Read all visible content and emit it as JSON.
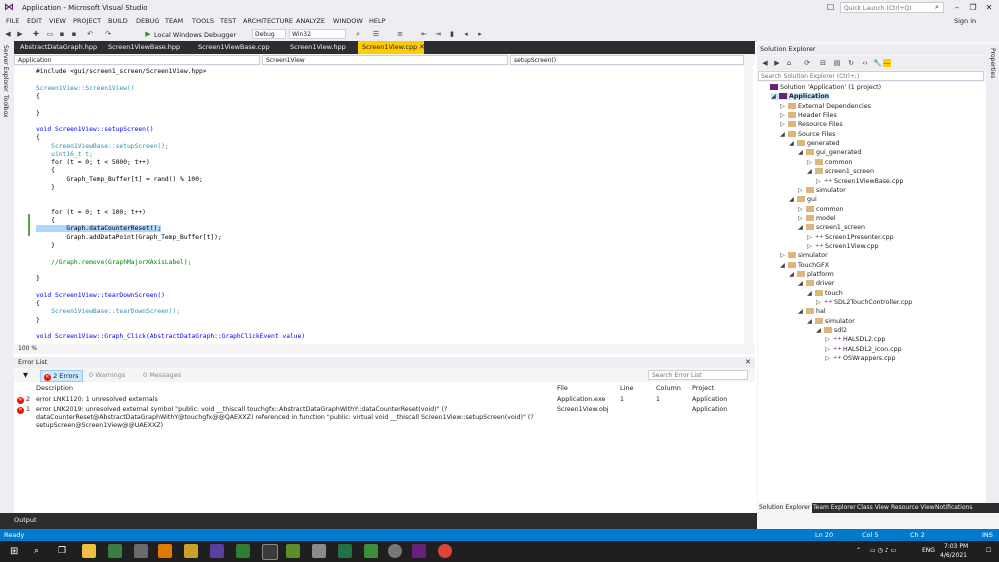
{
  "window": {
    "title": "Application - Microsoft Visual Studio",
    "quick_launch_placeholder": "Quick Launch (Ctrl+Q)",
    "sign_in": "Sign in"
  },
  "menu": [
    "FILE",
    "EDIT",
    "VIEW",
    "PROJECT",
    "BUILD",
    "DEBUG",
    "TEAM",
    "TOOLS",
    "TEST",
    "ARCHITECTURE",
    "ANALYZE",
    "WINDOW",
    "HELP"
  ],
  "toolbar": {
    "debugger_label": "Local Windows Debugger",
    "config": "Debug",
    "platform": "Win32"
  },
  "side_tabs": [
    "Server Explorer",
    "Toolbox"
  ],
  "right_side_tab": "Properties",
  "doc_tabs": [
    "AbstractDataGraph.hpp",
    "Screen1ViewBase.hpp",
    "Screen1ViewBase.cpp",
    "Screen1View.hpp",
    "Screen1View.cpp"
  ],
  "navbar": {
    "project": "Application",
    "scope": "Screen1View",
    "member": "setupScreen()"
  },
  "code": [
    "#include <gui/screen1_screen/Screen1View.hpp>",
    "",
    "Screen1View::Screen1View()",
    "{",
    "",
    "}",
    "",
    "void Screen1View::setupScreen()",
    "{",
    "    Screen1ViewBase::setupScreen();",
    "    uint16_t t;",
    "    for (t = 0; t < 5000; t++)",
    "    {",
    "        Graph_Temp_Buffer[t] = rand() % 100;",
    "    }",
    "",
    "",
    "    for (t = 0; t < 100; t++)",
    "    {",
    "        Graph.dataCounterReset();",
    "        Graph.addDataPoint(Graph_Temp_Buffer[t]);",
    "    }",
    "",
    "    //Graph.remove(GraphMajorXAxisLabel);",
    "",
    "}",
    "",
    "void Screen1View::tearDownScreen()",
    "{",
    "    Screen1ViewBase::tearDownScreen();",
    "}",
    "",
    "void Screen1View::Graph_Click(AbstractDataGraph::GraphClickEvent value)"
  ],
  "zoom": "100 %",
  "error_list": {
    "title": "Error List",
    "errors_filter": "2 Errors",
    "warnings_filter": "0 Warnings",
    "messages_filter": "0 Messages",
    "search_placeholder": "Search Error List",
    "columns": [
      "Description",
      "File",
      "Line",
      "Column",
      "Project"
    ],
    "rows": [
      {
        "num": "2",
        "description": "error LNK1120: 1 unresolved externals",
        "file": "Application.exe",
        "line": "1",
        "column": "1",
        "project": "Application"
      },
      {
        "num": "1",
        "description_lines": [
          "error LNK2019: unresolved external symbol \"public: void __thiscall touchgfx::AbstractDataGraphWithY::dataCounterReset(void)\" (?",
          "dataCounterReset@AbstractDataGraphWithY@touchgfx@@QAEXXZ) referenced in function \"public: virtual void __thiscall Screen1View::setupScreen(void)\" (?",
          "setupScreen@Screen1View@@UAEXXZ)"
        ],
        "file": "Screen1View.obj",
        "line": "",
        "column": "",
        "project": "Application"
      }
    ]
  },
  "output_tab": "Output",
  "solution_explorer": {
    "title": "Solution Explorer",
    "search_placeholder": "Search Solution Explorer (Ctrl+;)",
    "tree": [
      {
        "label": "Solution 'Application' (1 project)",
        "depth": 0,
        "kind": "solution",
        "arrow": ""
      },
      {
        "label": "Application",
        "depth": 1,
        "kind": "project",
        "arrow": "◢",
        "selected": true
      },
      {
        "label": "External Dependencies",
        "depth": 2,
        "kind": "folder",
        "arrow": "▷"
      },
      {
        "label": "Header Files",
        "depth": 2,
        "kind": "folder",
        "arrow": "▷"
      },
      {
        "label": "Resource Files",
        "depth": 2,
        "kind": "folder",
        "arrow": "▷"
      },
      {
        "label": "Source Files",
        "depth": 2,
        "kind": "folder",
        "arrow": "◢"
      },
      {
        "label": "generated",
        "depth": 3,
        "kind": "folder",
        "arrow": "◢"
      },
      {
        "label": "gui_generated",
        "depth": 4,
        "kind": "folder",
        "arrow": "◢"
      },
      {
        "label": "common",
        "depth": 5,
        "kind": "folder",
        "arrow": "▷"
      },
      {
        "label": "screen1_screen",
        "depth": 5,
        "kind": "folder",
        "arrow": "◢"
      },
      {
        "label": "Screen1ViewBase.cpp",
        "depth": 6,
        "kind": "cpp",
        "arrow": "▷"
      },
      {
        "label": "simulator",
        "depth": 4,
        "kind": "folder",
        "arrow": "▷"
      },
      {
        "label": "gui",
        "depth": 3,
        "kind": "folder",
        "arrow": "◢"
      },
      {
        "label": "common",
        "depth": 4,
        "kind": "folder",
        "arrow": "▷"
      },
      {
        "label": "model",
        "depth": 4,
        "kind": "folder",
        "arrow": "▷"
      },
      {
        "label": "screen1_screen",
        "depth": 4,
        "kind": "folder",
        "arrow": "◢"
      },
      {
        "label": "Screen1Presenter.cpp",
        "depth": 5,
        "kind": "cpp",
        "arrow": "▷"
      },
      {
        "label": "Screen1View.cpp",
        "depth": 5,
        "kind": "cpp",
        "arrow": "▷"
      },
      {
        "label": "simulator",
        "depth": 2,
        "kind": "folder",
        "arrow": "▷"
      },
      {
        "label": "TouchGFX",
        "depth": 2,
        "kind": "folder",
        "arrow": "◢"
      },
      {
        "label": "platform",
        "depth": 3,
        "kind": "folder",
        "arrow": "◢"
      },
      {
        "label": "driver",
        "depth": 4,
        "kind": "folder",
        "arrow": "◢"
      },
      {
        "label": "touch",
        "depth": 5,
        "kind": "folder",
        "arrow": "◢"
      },
      {
        "label": "SDL2TouchController.cpp",
        "depth": 6,
        "kind": "cpp",
        "arrow": "▷"
      },
      {
        "label": "hal",
        "depth": 4,
        "kind": "folder",
        "arrow": "◢"
      },
      {
        "label": "simulator",
        "depth": 5,
        "kind": "folder",
        "arrow": "◢"
      },
      {
        "label": "sdl2",
        "depth": 6,
        "kind": "folder",
        "arrow": "◢"
      },
      {
        "label": "HALSDL2.cpp",
        "depth": 7,
        "kind": "cpp",
        "arrow": "▷"
      },
      {
        "label": "HALSDL2_icon.cpp",
        "depth": 7,
        "kind": "cpp",
        "arrow": "▷"
      },
      {
        "label": "OSWrappers.cpp",
        "depth": 7,
        "kind": "cpp",
        "arrow": "▷"
      }
    ],
    "bottom_tabs": [
      "Solution Explorer",
      "Team Explorer",
      "Class View",
      "Resource View",
      "Notifications"
    ]
  },
  "status": {
    "ready": "Ready",
    "ln": "Ln 20",
    "col": "Col 5",
    "ch": "Ch 2",
    "ins": "INS"
  },
  "taskbar": {
    "lang": "ENG",
    "time": "7:03 PM",
    "date": "4/6/2021"
  },
  "colors": {
    "accent": "#007acc",
    "active_tab": "#ffcc00",
    "error": "#e51400",
    "dark": "#2d2d30"
  }
}
